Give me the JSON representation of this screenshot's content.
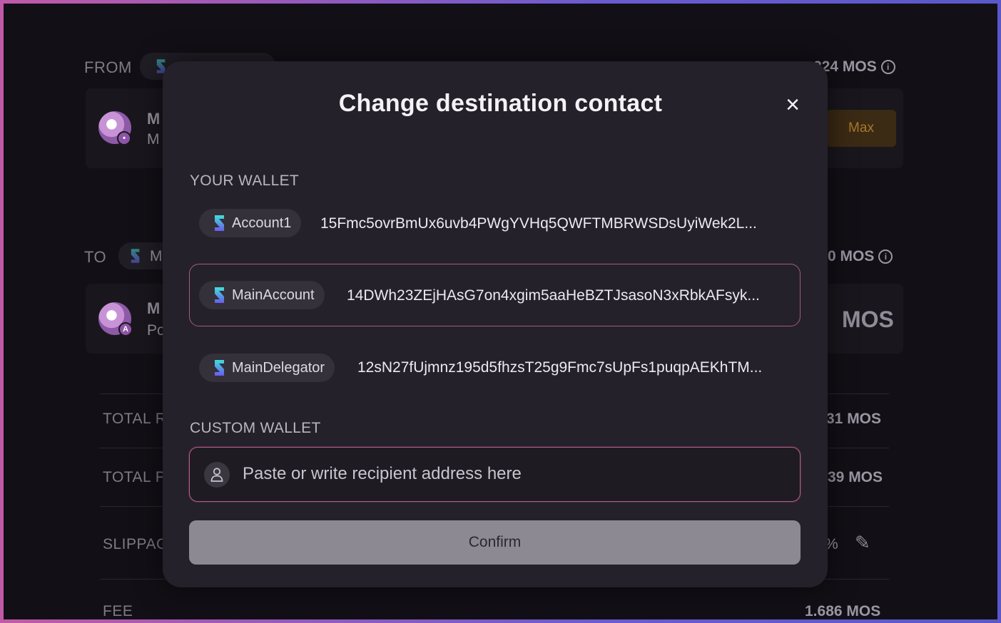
{
  "background": {
    "from_label": "FROM",
    "from_balance": "224 MOS",
    "from_token_line1": "M",
    "from_token_line2": "M",
    "max_label": "Max",
    "to_label": "TO",
    "to_chip_text": "M",
    "to_balance": "0 MOS",
    "to_token_line1": "M",
    "to_token_line2": "Po",
    "to_amount_unit": "MOS",
    "rows": [
      {
        "label": "TOTAL R",
        "value": "31 MOS"
      },
      {
        "label": "TOTAL P",
        "value": "39 MOS"
      },
      {
        "label": "SLIPPAG",
        "value": "%"
      },
      {
        "label": "FEE",
        "value": "1.686 MOS"
      }
    ]
  },
  "modal": {
    "title": "Change destination contact",
    "close_icon": "close-icon",
    "your_wallet_label": "YOUR WALLET",
    "wallets": [
      {
        "name": "Account1",
        "address": "15Fmc5ovrBmUx6uvb4PWgYVHq5QWFTMBRWSDsUyiWek2L...",
        "selected": false
      },
      {
        "name": "MainAccount",
        "address": "14DWh23ZEjHAsG7on4xgim5aaHeBZTJsasoN3xRbkAFsyk...",
        "selected": true
      },
      {
        "name": "MainDelegator",
        "address": "12sN27fUjmnz195d5fhzsT25g9Fmc7sUpFs1puqpAEKhTM...",
        "selected": false
      }
    ],
    "custom_wallet_label": "CUSTOM WALLET",
    "custom_input": {
      "value": "",
      "placeholder": "Paste or write recipient address here"
    },
    "confirm_label": "Confirm"
  },
  "colors": {
    "accent_border": "#b25a8b",
    "logo_gradient_top": "#3fe0d8",
    "logo_gradient_bottom": "#6a5cf0",
    "modal_bg": "#24212a"
  }
}
